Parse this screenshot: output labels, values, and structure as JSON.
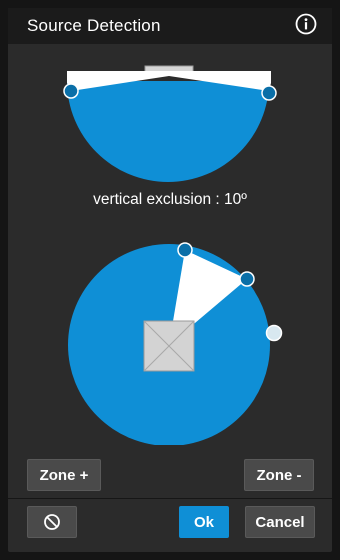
{
  "dialog": {
    "title": "Source Detection"
  },
  "vertical_view": {
    "exclusion_label": "vertical exclusion : 10º",
    "exclusion_degrees": 10
  },
  "zone_buttons": {
    "add_label": "Zone +",
    "remove_label": "Zone -"
  },
  "footer": {
    "ok_label": "Ok",
    "cancel_label": "Cancel"
  },
  "colors": {
    "accent": "#0f8fd6",
    "handle": "#0a6fa8",
    "handle_inactive": "#d8e8f0",
    "background": "#2b2b2b",
    "titlebar": "#1b1b1b",
    "button": "#4a4a4a"
  },
  "icons": {
    "info": "info-icon",
    "reset": "no-entry-icon"
  }
}
